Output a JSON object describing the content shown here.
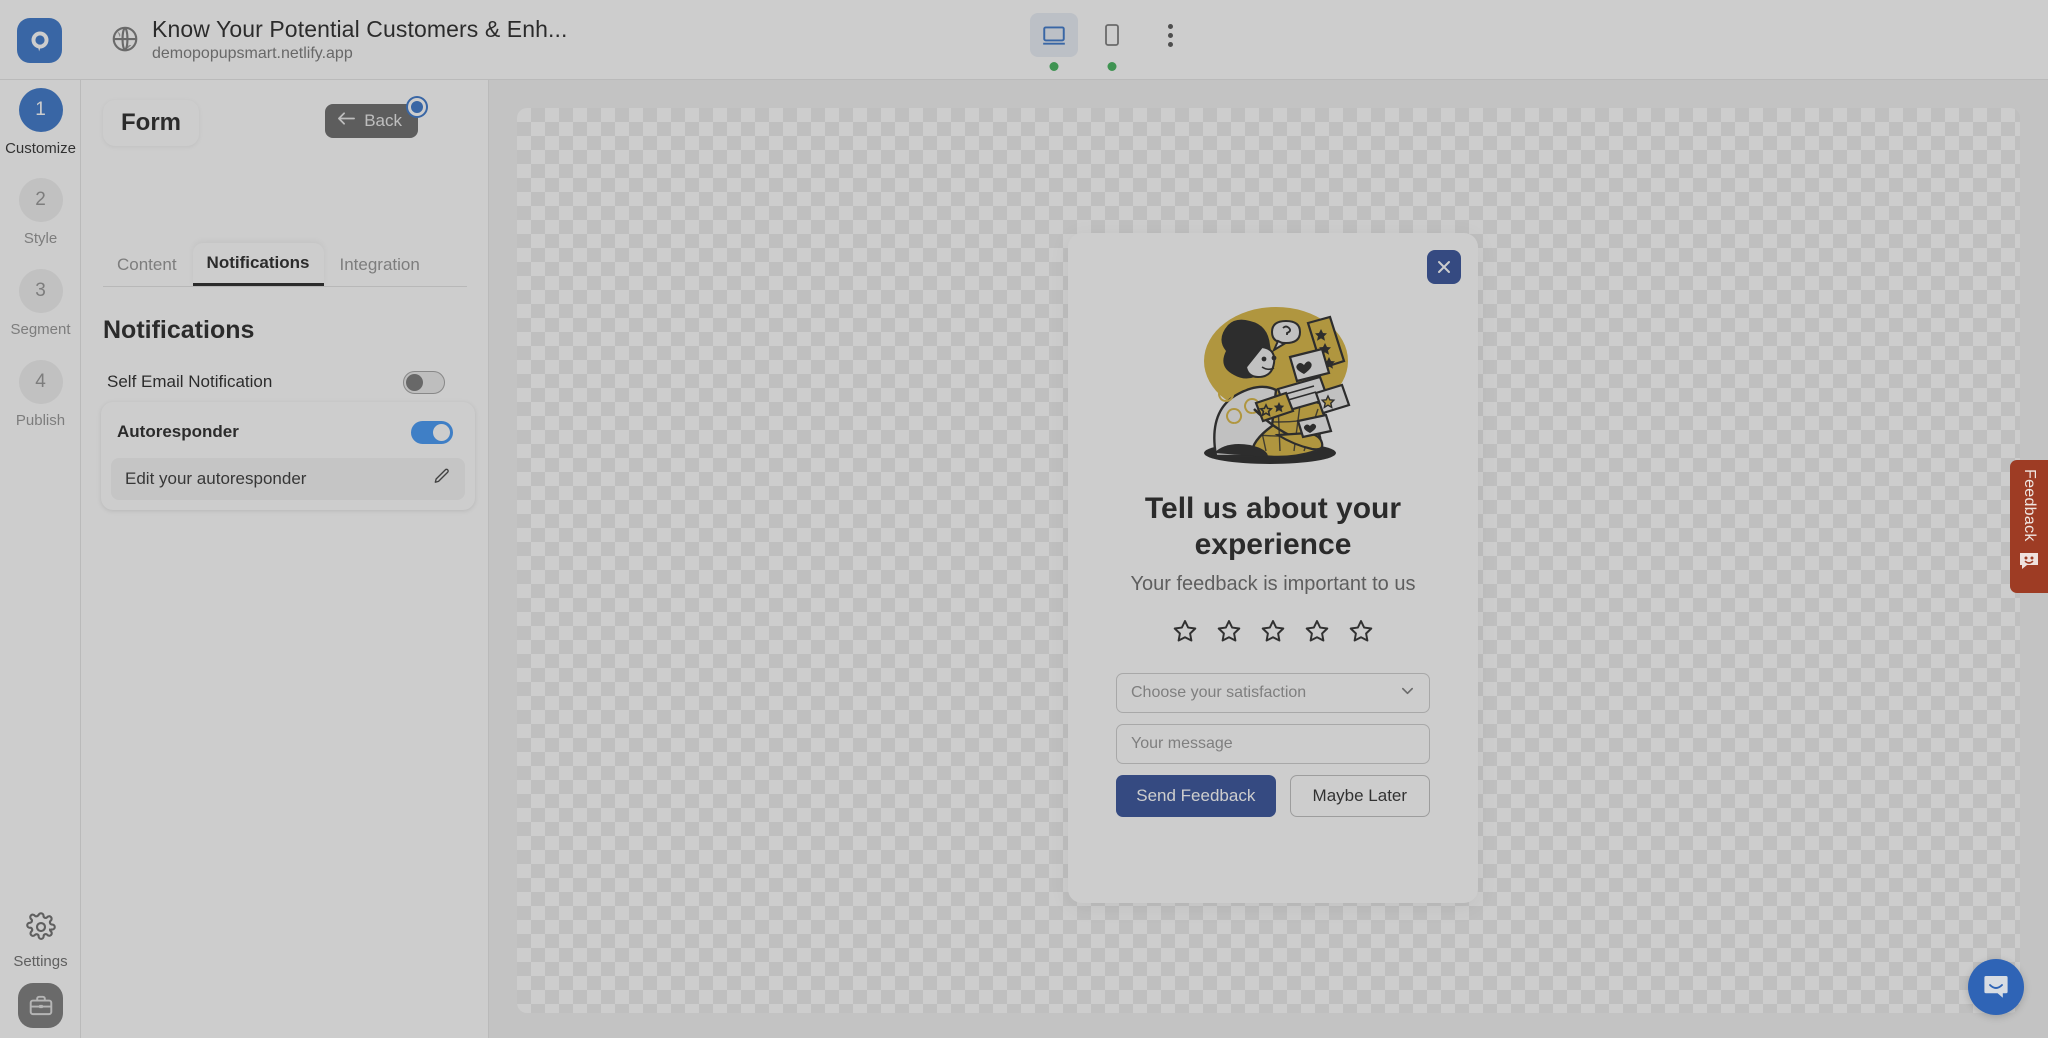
{
  "header": {
    "logo_icon": "popupsmart-logo-icon",
    "site_icon": "globe-icon",
    "title": "Know Your Potential Customers & Enh...",
    "url": "demopopupsmart.netlify.app",
    "devices": [
      {
        "name": "desktop",
        "icon": "desktop-icon",
        "active": true
      },
      {
        "name": "mobile",
        "icon": "mobile-icon",
        "active": false
      }
    ],
    "more_icon": "three-dots-icon"
  },
  "rail": {
    "steps": [
      {
        "number": "1",
        "label": "Customize",
        "active": true
      },
      {
        "number": "2",
        "label": "Style",
        "active": false
      },
      {
        "number": "3",
        "label": "Segment",
        "active": false
      },
      {
        "number": "4",
        "label": "Publish",
        "active": false
      }
    ],
    "settings_label": "Settings",
    "settings_icon": "gear-icon",
    "workspace_icon": "briefcase-icon"
  },
  "panel": {
    "chip_label": "Form",
    "back_label": "Back",
    "back_icon": "arrow-left-icon",
    "tabs": [
      {
        "label": "Content",
        "active": false
      },
      {
        "label": "Notifications",
        "active": true
      },
      {
        "label": "Integration",
        "active": false
      }
    ],
    "section_title": "Notifications",
    "self_email": {
      "label": "Self Email Notification",
      "enabled": false
    },
    "autoresponder": {
      "label": "Autoresponder",
      "enabled": true
    },
    "edit_autoresponder": {
      "label": "Edit your autoresponder",
      "icon": "pencil-icon"
    }
  },
  "popup": {
    "close_icon": "close-icon",
    "illustration": "woman-with-feedback-basket-illustration",
    "heading": "Tell us about your experience",
    "subheading": "Your feedback is important to us",
    "stars": {
      "count": 5,
      "filled": 0,
      "icon": "star-outline-icon"
    },
    "satisfaction_placeholder": "Choose your satisfaction",
    "satisfaction_value": "",
    "chevron_icon": "chevron-down-icon",
    "message_placeholder": "Your message",
    "message_value": "",
    "primary_button": "Send Feedback",
    "secondary_button": "Maybe Later"
  },
  "widgets": {
    "feedback_tab_label": "Feedback",
    "feedback_tab_icon": "smiley-face-icon",
    "chat_launcher_icon": "chat-bubble-icon"
  },
  "colors": {
    "brand_blue": "#2568c4",
    "toggle_on": "#2f8cf5",
    "popup_primary": "#1f3f8f",
    "feedback_tab": "#9e3c24",
    "status_dot_green": "#2eaa4a"
  }
}
